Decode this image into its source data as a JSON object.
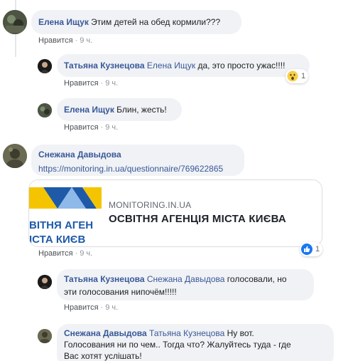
{
  "comments": [
    {
      "author": "Елена Ищук",
      "text": "Этим детей на обед кормили???",
      "like_label": "Нравится",
      "time": "9 ч."
    },
    {
      "author": "Татьяна Кузнецова",
      "mention": "Елена Ищук",
      "text": "да, это просто ужас!!!!",
      "like_label": "Нравится",
      "time": "9 ч.",
      "reaction": {
        "icon": "wow-emoji-icon",
        "count": "1"
      }
    },
    {
      "author": "Елена Ищук",
      "text": "Блин, жесть!",
      "like_label": "Нравится",
      "time": "9 ч."
    },
    {
      "author": "Снежана Давыдова",
      "link": "https://monitoring.in.ua/questionnaire/769622865",
      "preview": {
        "domain": "MONITORING.IN.UA",
        "title": "ОСВІТНЯ АГЕНЦІЯ МІСТА КИЄВА",
        "logo_line1": "ВІТНЯ АГЕН",
        "logo_line2": "ІСТА КИЄВ"
      },
      "like_label": "Нравится",
      "time": "9 ч.",
      "reaction": {
        "icon": "like-thumb-icon",
        "count": "1"
      }
    },
    {
      "author": "Татьяна Кузнецова",
      "mention": "Снежана Давыдова",
      "text_line1": "голосовали, но",
      "text_line2": "эти голосования нипочём!!!!!",
      "like_label": "Нравится",
      "time": "9 ч."
    },
    {
      "author": "Снежана Давыдова",
      "mention": "Татьяна Кузнецова",
      "text_line1": "Ну вот.",
      "text_line2": "Голосования ни по чем.. Тогда что? Жалуйтесь туда - где",
      "text_line3": "Вас хотят услішать!"
    }
  ],
  "colors": {
    "bubble": "#f0f2f5",
    "name": "#385898",
    "meta": "#90949c",
    "like_blue": "#1877f2",
    "logo_blue": "#1e5aa8",
    "logo_yellow": "#f5c400"
  }
}
